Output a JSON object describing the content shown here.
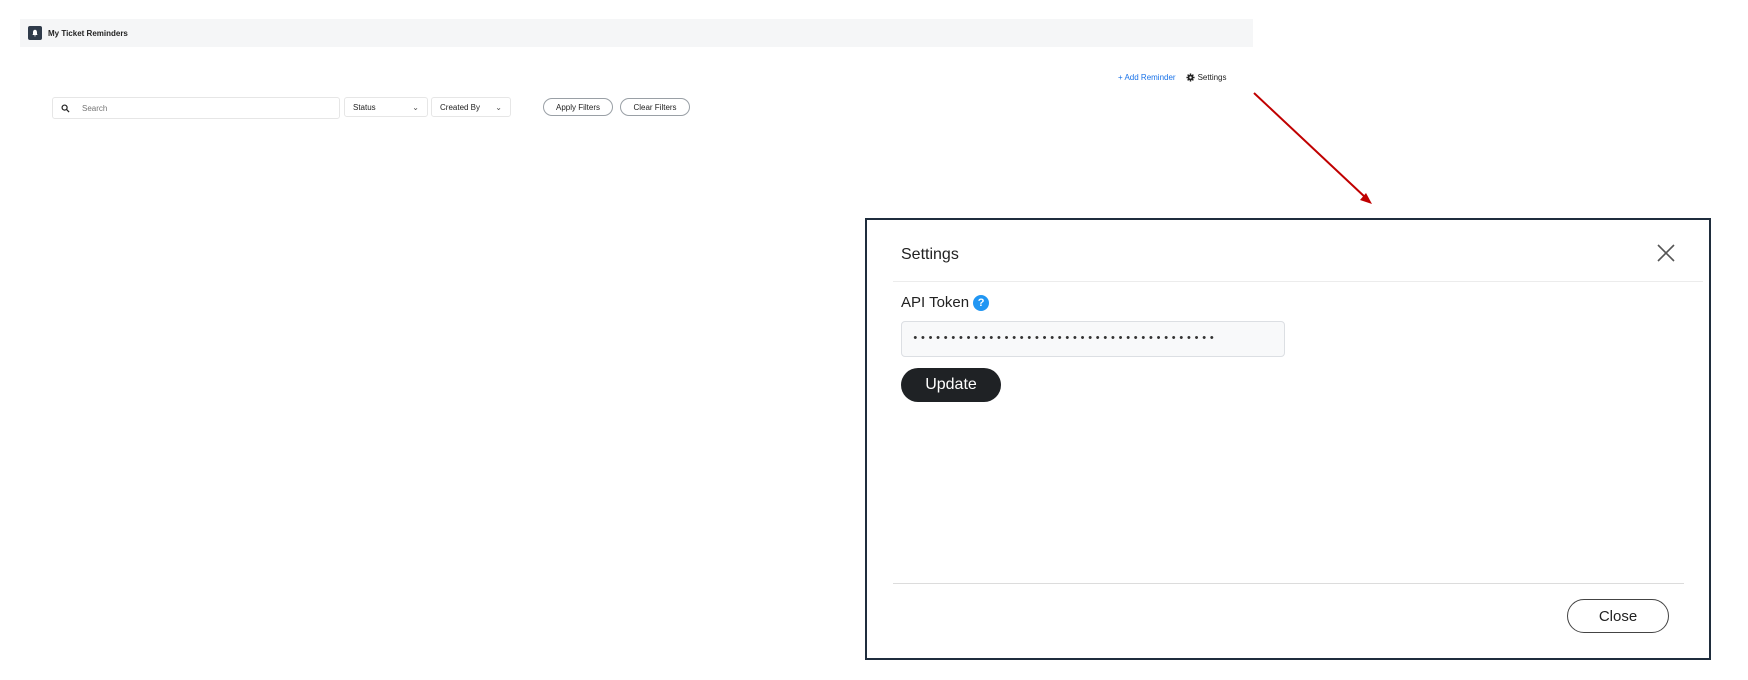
{
  "app": {
    "title": "My Ticket Reminders",
    "icon": "bell-icon"
  },
  "toolbar": {
    "add_reminder": "+ Add Reminder",
    "settings": "Settings",
    "accent_color": "#1a73e8"
  },
  "filters": {
    "search_placeholder": "Search",
    "status_label": "Status",
    "created_by_label": "Created By",
    "apply_label": "Apply Filters",
    "clear_label": "Clear Filters"
  },
  "modal": {
    "title": "Settings",
    "api_token_label": "API Token",
    "help_glyph": "?",
    "token_value": "••••••••••••••••••••••••••••••••••••••••",
    "update_label": "Update",
    "close_label": "Close"
  },
  "annotation": {
    "arrow_color": "#c00000"
  }
}
